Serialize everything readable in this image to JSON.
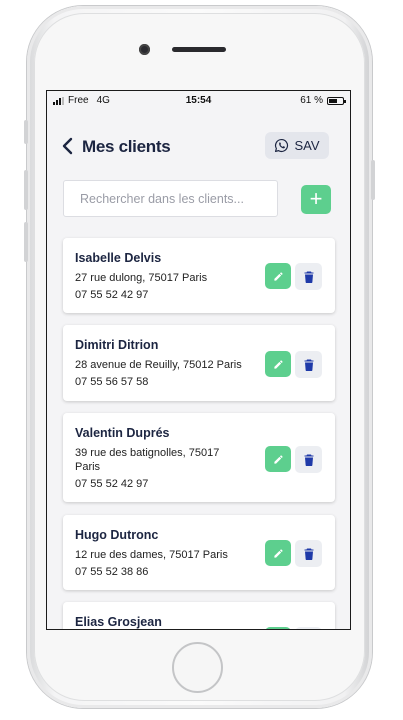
{
  "status_bar": {
    "carrier": "Free",
    "network": "4G",
    "time": "15:54",
    "battery": "61 %",
    "battery_level": 0.61
  },
  "header": {
    "back_icon": "chevron-left-icon",
    "title": "Mes clients",
    "sav_label": "SAV",
    "sav_icon": "whatsapp-icon"
  },
  "search": {
    "placeholder": "Rechercher dans les clients...",
    "value": ""
  },
  "add_button": {
    "label": "+",
    "icon": "plus-icon"
  },
  "colors": {
    "accent_green": "#5dcf8e",
    "navy": "#1c2541",
    "delete_icon": "#1f3aa8"
  },
  "clients": [
    {
      "name": "Isabelle Delvis",
      "address": "27 rue dulong, 75017 Paris",
      "phone": "07 55 52 42 97"
    },
    {
      "name": "Dimitri Ditrion",
      "address": "28 avenue de Reuilly, 75012 Paris",
      "phone": "07 55 56 57 58"
    },
    {
      "name": "Valentin Duprés",
      "address": "39 rue des batignolles, 75017 Paris",
      "phone": "07 55 52 42 97"
    },
    {
      "name": "Hugo Dutronc",
      "address": "12 rue des dames, 75017 Paris",
      "phone": "07 55 52 38 86"
    },
    {
      "name": "Elias Grosjean",
      "address": "",
      "phone": ""
    }
  ]
}
